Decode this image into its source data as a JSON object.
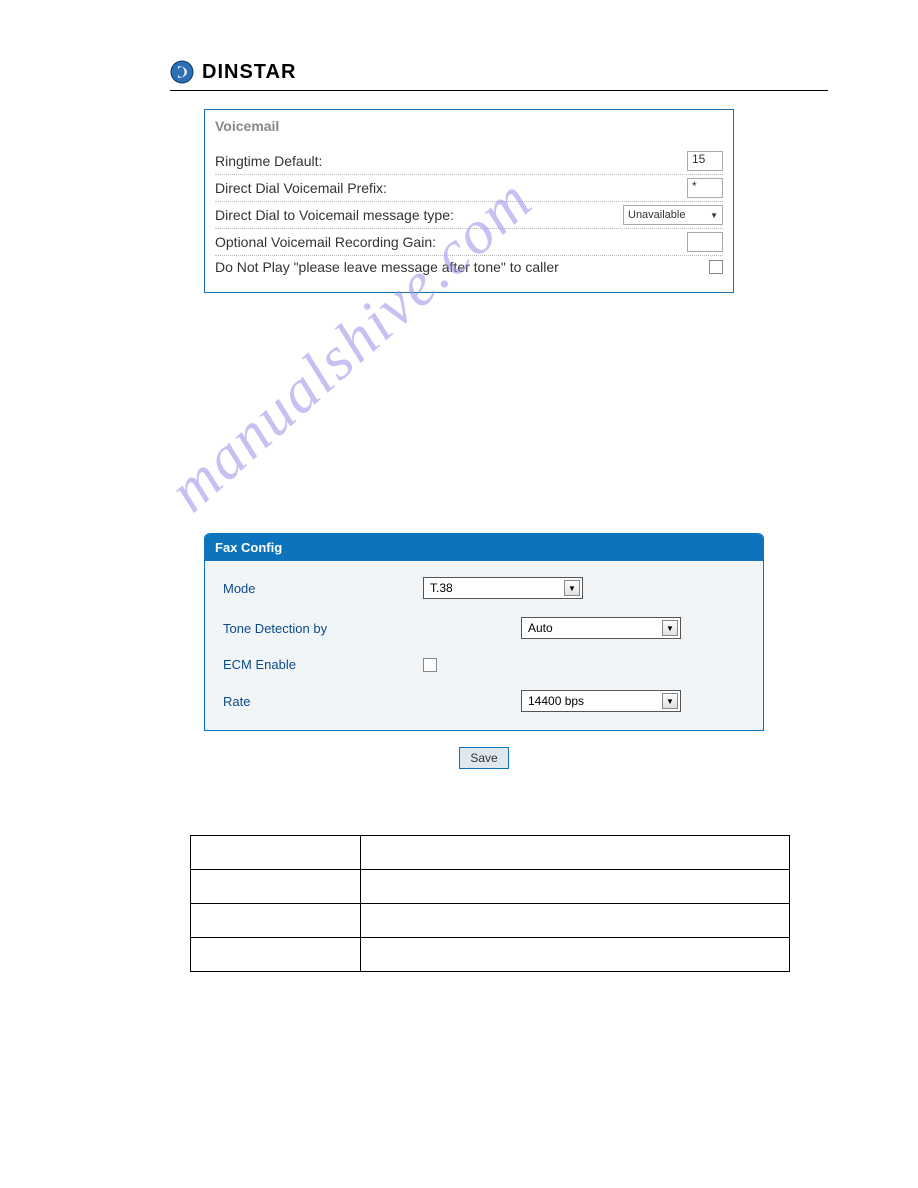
{
  "brand": "DINSTAR",
  "watermark": "manualshive.com",
  "voicemail": {
    "title": "Voicemail",
    "rows": {
      "ringtime_label": "Ringtime Default:",
      "ringtime_value": "15",
      "prefix_label": "Direct Dial Voicemail Prefix:",
      "prefix_value": "*",
      "msgtype_label": "Direct Dial to Voicemail message type:",
      "msgtype_value": "Unavailable",
      "gain_label": "Optional Voicemail Recording Gain:",
      "gain_value": "",
      "noplay_label": "Do Not Play \"please leave message after tone\" to caller"
    }
  },
  "fax": {
    "title": "Fax Config",
    "mode_label": "Mode",
    "mode_value": "T.38",
    "tone_label": "Tone Detection by",
    "tone_value": "Auto",
    "ecm_label": "ECM Enable",
    "rate_label": "Rate",
    "rate_value": "14400 bps",
    "save_label": "Save"
  }
}
